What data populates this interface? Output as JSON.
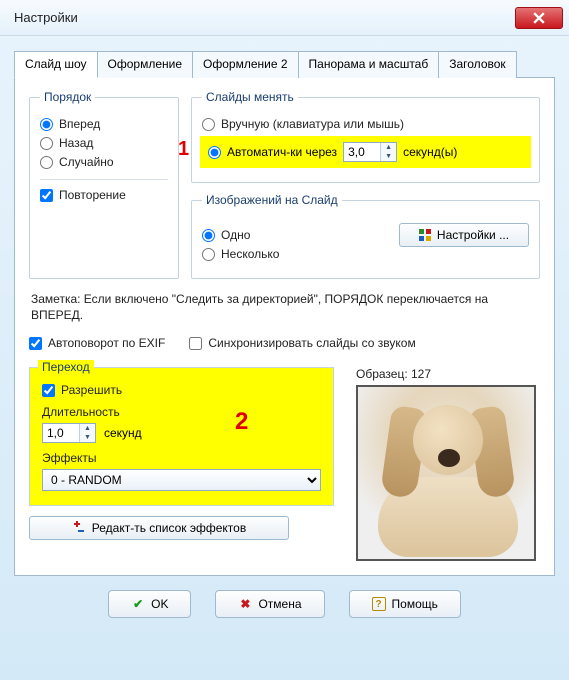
{
  "window": {
    "title": "Настройки"
  },
  "tabs": [
    "Слайд шоу",
    "Оформление",
    "Оформление 2",
    "Панорама и масштаб",
    "Заголовок"
  ],
  "markers": {
    "one": "1",
    "two": "2"
  },
  "order": {
    "legend": "Порядок",
    "forward": "Вперед",
    "back": "Назад",
    "random": "Случайно",
    "repeat": "Повторение"
  },
  "change": {
    "legend": "Слайды менять",
    "manual": "Вручную (клавиатура или мышь)",
    "auto": "Автоматич-ки через",
    "auto_seconds": "3,0",
    "seconds_suffix": "секунд(ы)"
  },
  "imagesPerSlide": {
    "legend": "Изображений на Слайд",
    "one": "Одно",
    "many": "Несколько",
    "settings_btn": "Настройки ..."
  },
  "note": "Заметка: Если включено \"Следить за директорией\", ПОРЯДОК переключается на ВПЕРЕД.",
  "exif": "Автоповорот по EXIF",
  "sync": "Синхронизировать слайды со звуком",
  "transition": {
    "legend": "Переход",
    "enable": "Разрешить",
    "duration_label": "Длительность",
    "duration_value": "1,0",
    "duration_suffix": "секунд",
    "effects_label": "Эффекты",
    "effects_value": "0 - RANDOM",
    "edit_btn": "Редакт-ть список эффектов"
  },
  "sample": {
    "label": "Образец: 127"
  },
  "buttons": {
    "ok": "OK",
    "cancel": "Отмена",
    "help": "Помощь"
  }
}
